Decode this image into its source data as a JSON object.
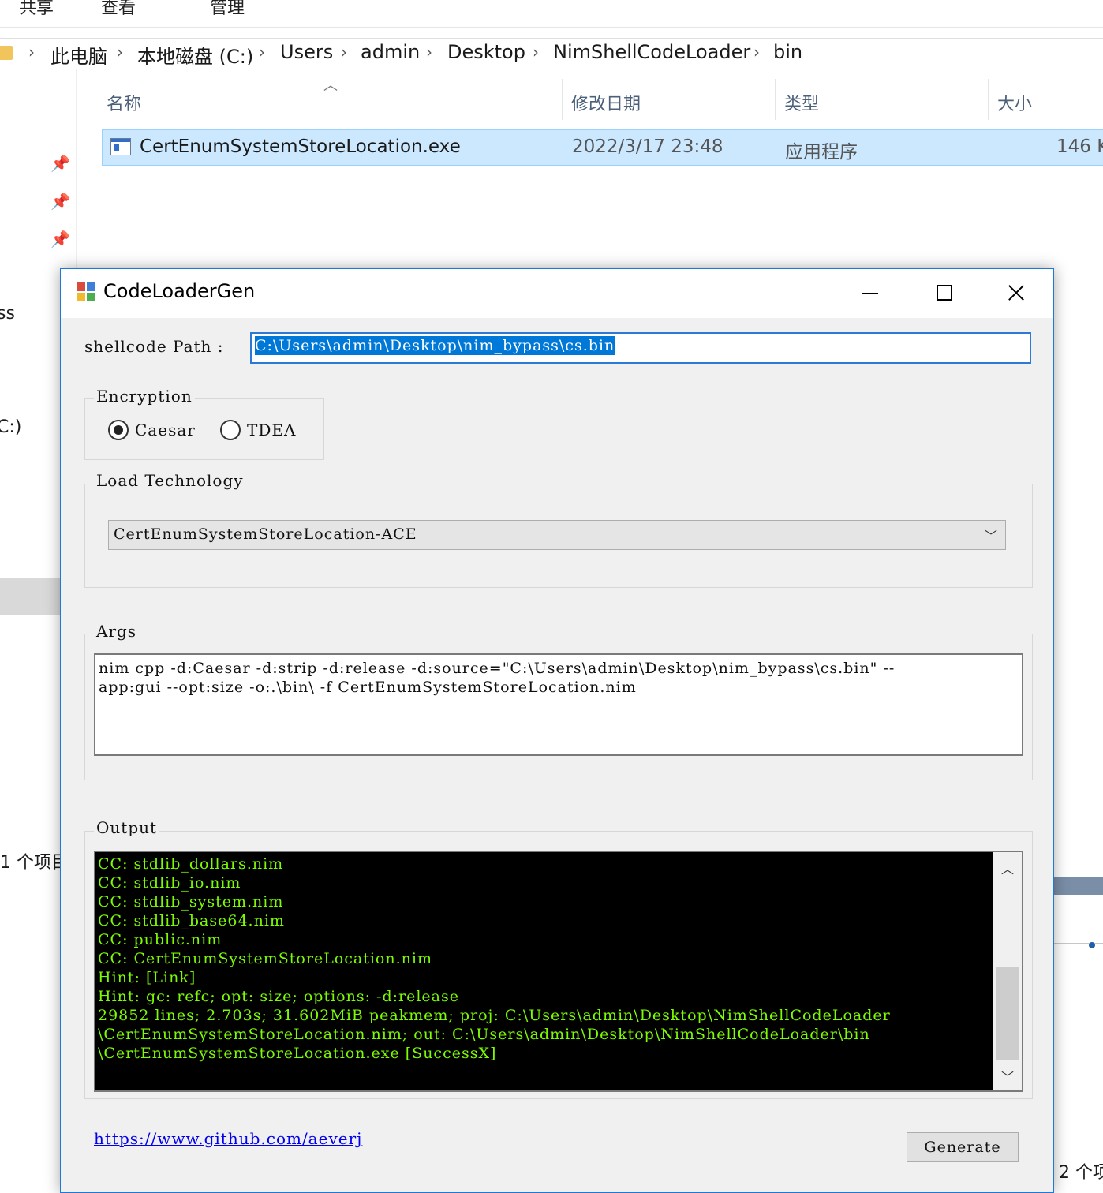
{
  "explorer": {
    "ribbon_tabs": [
      "共享",
      "查看",
      "管理"
    ],
    "breadcrumb": [
      "此电脑",
      "本地磁盘 (C:)",
      "Users",
      "admin",
      "Desktop",
      "NimShellCodeLoader",
      "bin"
    ],
    "nav_items": [
      "ss",
      "C:)"
    ],
    "columns": {
      "name": "名称",
      "modified": "修改日期",
      "type": "类型",
      "size": "大小"
    },
    "file": {
      "name": "CertEnumSystemStoreLocation.exe",
      "modified": "2022/3/17 23:48",
      "type": "应用程序",
      "size": "146 K"
    },
    "status_left": "1 个项目",
    "status_right": "2 个项"
  },
  "dialog": {
    "title": "CodeLoaderGen",
    "path_label": "shellcode Path :",
    "path_value": "C:\\Users\\admin\\Desktop\\nim_bypass\\cs.bin",
    "encryption": {
      "group_title": "Encryption",
      "options": [
        "Caesar",
        "TDEA"
      ],
      "selected": "Caesar"
    },
    "load": {
      "group_title": "Load Technology",
      "selected": "CertEnumSystemStoreLocation-ACE"
    },
    "args": {
      "group_title": "Args",
      "line1": "nim cpp -d:Caesar -d:strip -d:release -d:source=\"C:\\Users\\admin\\Desktop\\nim_bypass\\cs.bin\" --",
      "line2": "app:gui --opt:size -o:.\\bin\\ -f CertEnumSystemStoreLocation.nim"
    },
    "output": {
      "group_title": "Output",
      "lines": [
        "CC: stdlib_dollars.nim",
        "CC: stdlib_io.nim",
        "CC: stdlib_system.nim",
        "CC: stdlib_base64.nim",
        "CC: public.nim",
        "CC: CertEnumSystemStoreLocation.nim",
        "Hint:  [Link]",
        "Hint: gc: refc; opt: size; options: -d:release",
        "29852 lines; 2.703s; 31.602MiB peakmem; proj: C:\\Users\\admin\\Desktop\\NimShellCodeLoader",
        "\\CertEnumSystemStoreLocation.nim; out: C:\\Users\\admin\\Desktop\\NimShellCodeLoader\\bin",
        "\\CertEnumSystemStoreLocation.exe [SuccessX]"
      ],
      "text_color": "#7cfc00",
      "background": "#000000"
    },
    "link": "https://www.github.com/aeverj",
    "generate_label": "Generate"
  }
}
